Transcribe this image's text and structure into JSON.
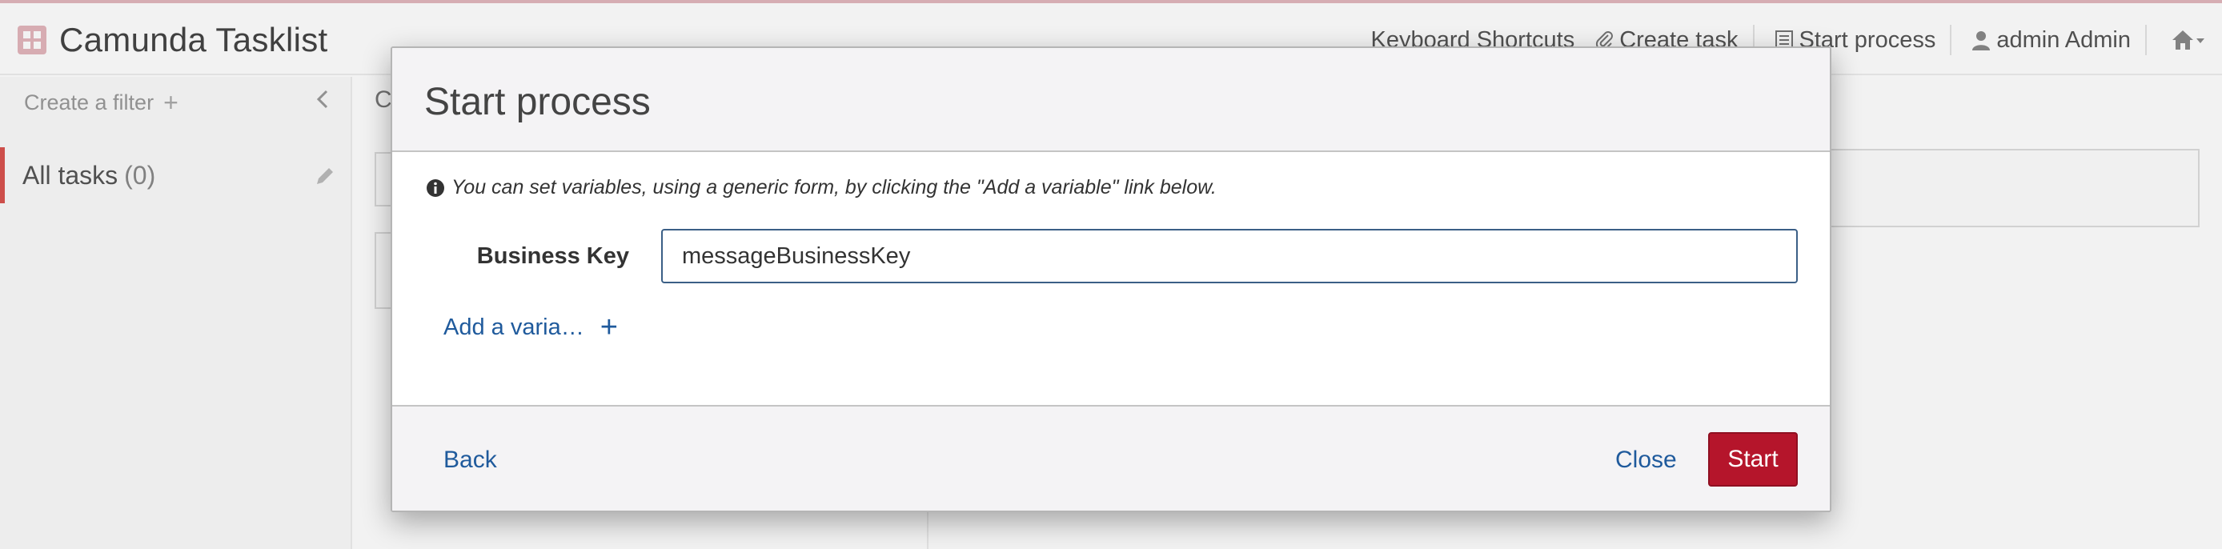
{
  "app": {
    "brand_name": "Camunda Tasklist",
    "nav": {
      "keyboard_shortcuts": "Keyboard Shortcuts",
      "create_task": "Create task",
      "start_process": "Start process",
      "user": "admin Admin"
    }
  },
  "sidebar": {
    "create_filter": "Create a filter",
    "filters": [
      {
        "label": "All tasks",
        "count": "(0)"
      }
    ]
  },
  "list": {
    "toolbar_initial": "C"
  },
  "modal": {
    "title": "Start process",
    "info": "You can set variables, using a generic form, by clicking the \"Add a variable\" link below.",
    "business_key_label": "Business Key",
    "business_key_value": "messageBusinessKey",
    "add_variable": "Add a varia…",
    "back": "Back",
    "close": "Close",
    "start": "Start"
  },
  "colors": {
    "primary_button": "#b5152b",
    "link": "#1f5a9c",
    "input_border": "#3b5f86",
    "active_filter_accent": "#d9534f"
  },
  "icons": [
    "info-circle-icon",
    "plus-icon",
    "pencil-icon",
    "chevron-left-icon",
    "paperclip-icon",
    "list-icon",
    "user-icon",
    "home-icon",
    "camunda-logo"
  ]
}
